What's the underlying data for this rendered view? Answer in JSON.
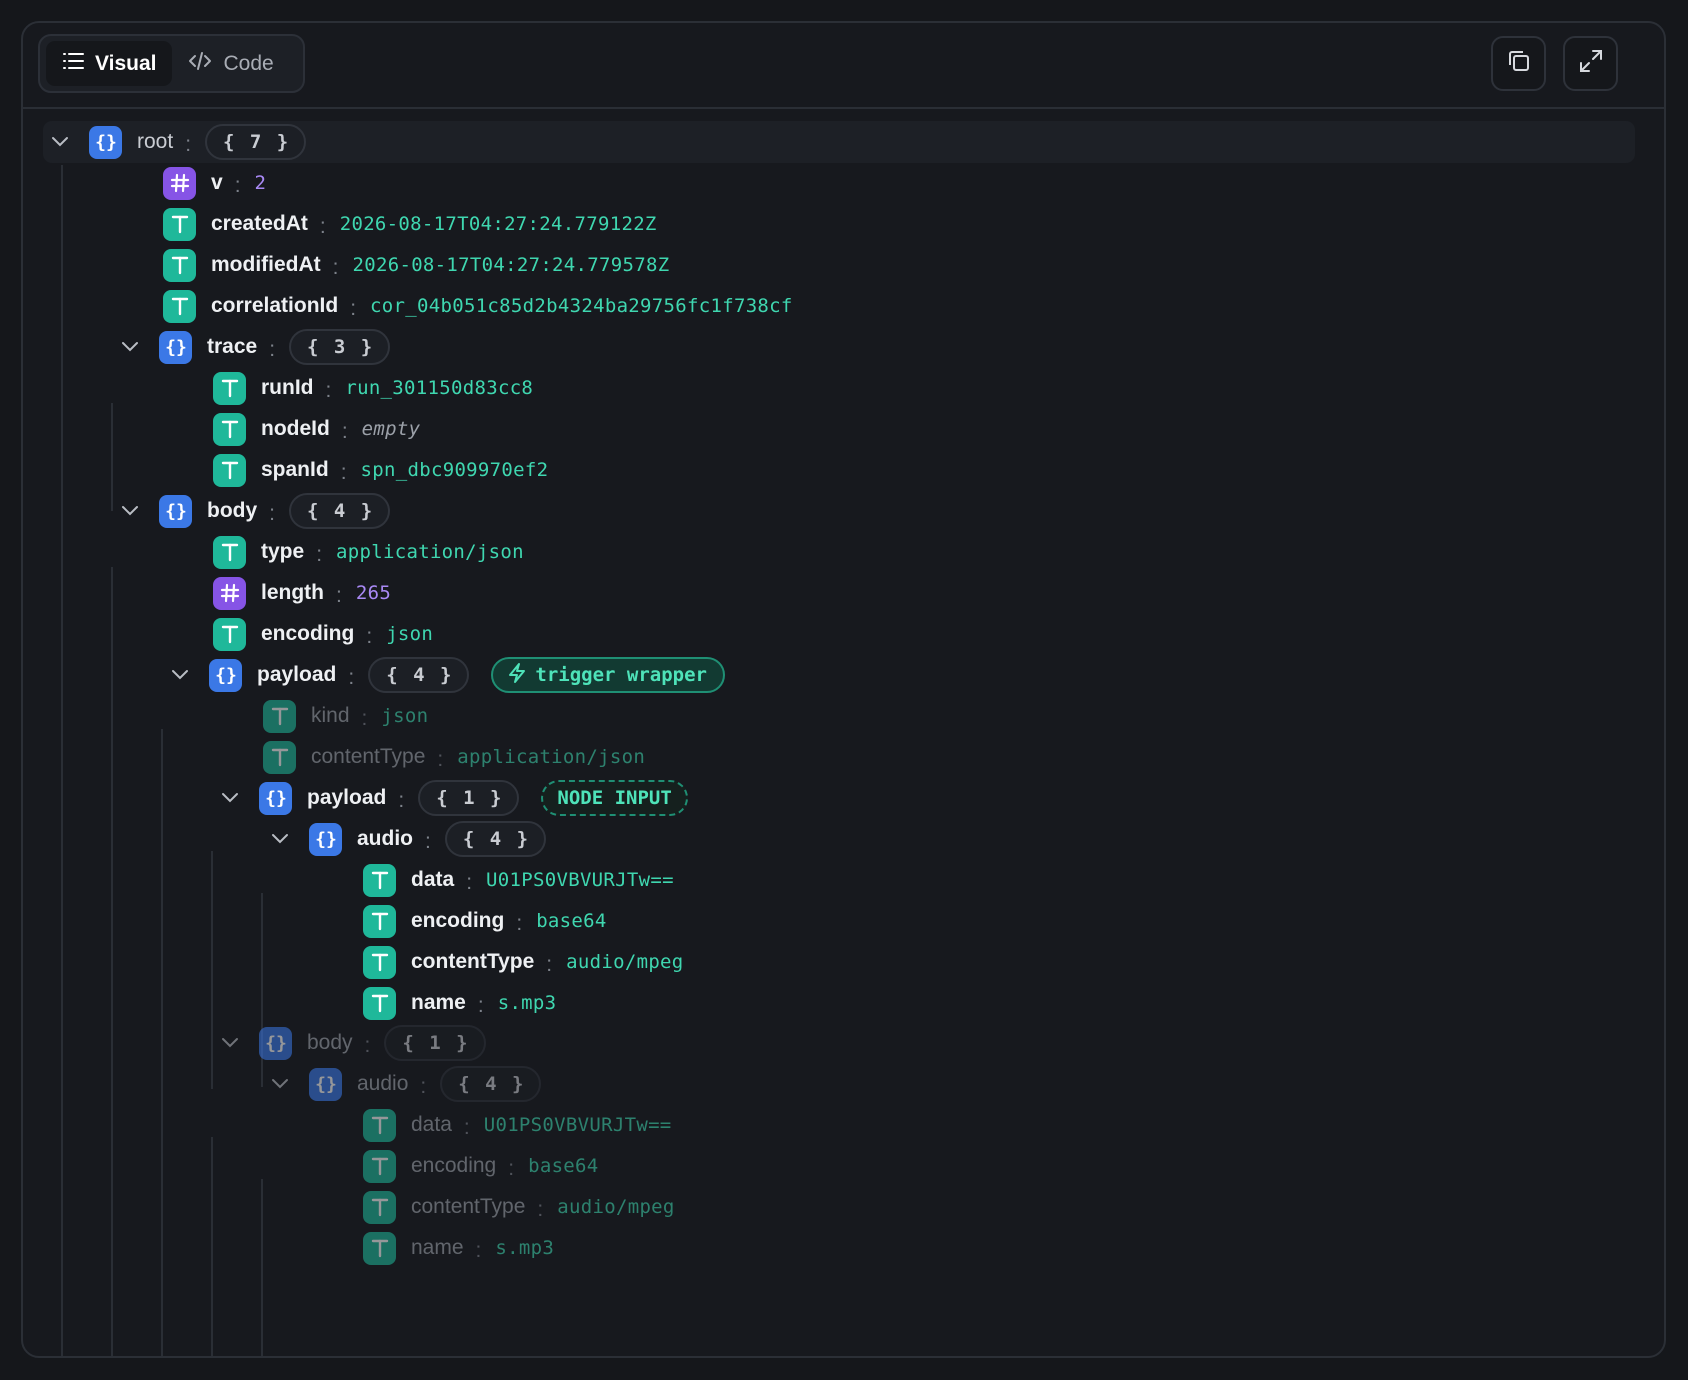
{
  "header": {
    "tabs": [
      {
        "label": "Visual",
        "icon": "list-icon",
        "active": true
      },
      {
        "label": "Code",
        "icon": "code-icon",
        "active": false
      }
    ],
    "actions": [
      {
        "name": "copy-button",
        "icon": "copy-icon"
      },
      {
        "name": "expand-button",
        "icon": "expand-icon"
      }
    ]
  },
  "tree": {
    "root": {
      "key": "root",
      "count": "{ 7 }"
    },
    "v": {
      "key": "v",
      "value": "2"
    },
    "createdAt": {
      "key": "createdAt",
      "value": "2026-08-17T04:27:24.779122Z"
    },
    "modifiedAt": {
      "key": "modifiedAt",
      "value": "2026-08-17T04:27:24.779578Z"
    },
    "correlationId": {
      "key": "correlationId",
      "value": "cor_04b051c85d2b4324ba29756fc1f738cf"
    },
    "trace": {
      "key": "trace",
      "count": "{ 3 }",
      "runId": {
        "key": "runId",
        "value": "run_301150d83cc8"
      },
      "nodeId": {
        "key": "nodeId",
        "value": "empty"
      },
      "spanId": {
        "key": "spanId",
        "value": "spn_dbc909970ef2"
      }
    },
    "body": {
      "key": "body",
      "count": "{ 4 }",
      "type": {
        "key": "type",
        "value": "application/json"
      },
      "length": {
        "key": "length",
        "value": "265"
      },
      "encoding": {
        "key": "encoding",
        "value": "json"
      },
      "payload": {
        "key": "payload",
        "count": "{ 4 }",
        "badge": "trigger wrapper",
        "kind": {
          "key": "kind",
          "value": "json"
        },
        "contentType": {
          "key": "contentType",
          "value": "application/json"
        },
        "payload": {
          "key": "payload",
          "count": "{ 1 }",
          "badge": "NODE INPUT",
          "audio": {
            "key": "audio",
            "count": "{ 4 }",
            "data": {
              "key": "data",
              "value": "U01PS0VBVURJTw=="
            },
            "encoding": {
              "key": "encoding",
              "value": "base64"
            },
            "contentType": {
              "key": "contentType",
              "value": "audio/mpeg"
            },
            "name": {
              "key": "name",
              "value": "s.mp3"
            }
          }
        },
        "body": {
          "key": "body",
          "count": "{ 1 }",
          "audio": {
            "key": "audio",
            "count": "{ 4 }",
            "data": {
              "key": "data",
              "value": "U01PS0VBVURJTw=="
            },
            "encoding": {
              "key": "encoding",
              "value": "base64"
            },
            "contentType": {
              "key": "contentType",
              "value": "audio/mpeg"
            },
            "name": {
              "key": "name",
              "value": "s.mp3"
            }
          }
        }
      }
    }
  },
  "colors": {
    "object_badge": "#3b78e6",
    "string_badge": "#1fb89a",
    "number_badge": "#8654e6",
    "string_value": "#3fd7b0",
    "number_value": "#a989f5",
    "accent_pill": "#1f8f74"
  }
}
